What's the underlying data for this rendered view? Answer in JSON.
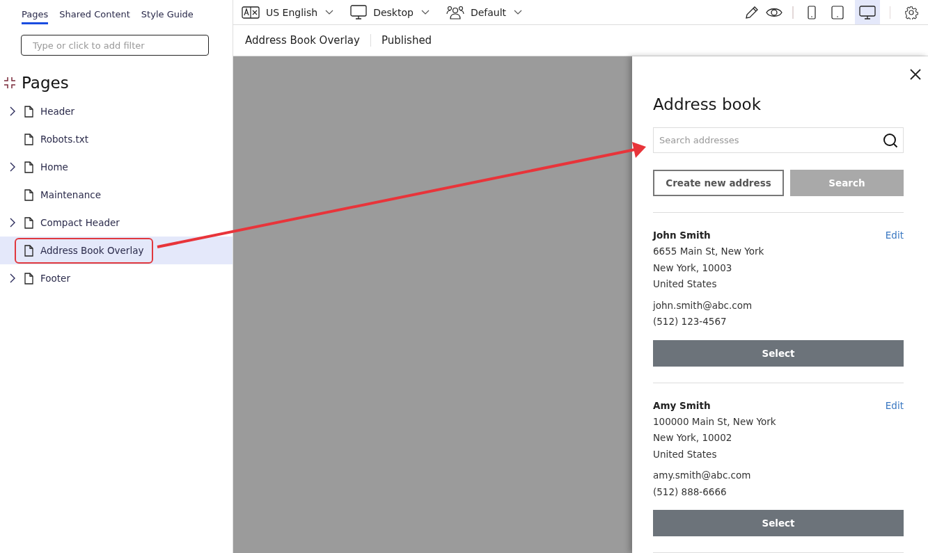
{
  "sidebar": {
    "tabs": [
      {
        "label": "Pages",
        "selected": true
      },
      {
        "label": "Shared Content",
        "selected": false
      },
      {
        "label": "Style Guide",
        "selected": false
      }
    ],
    "filter": {
      "placeholder": "Type or click to add filter"
    },
    "heading": "Pages",
    "items": [
      {
        "label": "Header",
        "expandable": true,
        "selected": false,
        "annotated": false
      },
      {
        "label": "Robots.txt",
        "expandable": false,
        "selected": false,
        "annotated": false
      },
      {
        "label": "Home",
        "expandable": true,
        "selected": false,
        "annotated": false
      },
      {
        "label": "Maintenance",
        "expandable": false,
        "selected": false,
        "annotated": false
      },
      {
        "label": "Compact Header",
        "expandable": true,
        "selected": false,
        "annotated": false
      },
      {
        "label": "Address Book Overlay",
        "expandable": false,
        "selected": true,
        "annotated": true
      },
      {
        "label": "Footer",
        "expandable": true,
        "selected": false,
        "annotated": false
      }
    ]
  },
  "toolbar": {
    "language": "US English",
    "device": "Desktop",
    "audience": "Default",
    "views": [
      {
        "kind": "phone",
        "selected": false
      },
      {
        "kind": "tablet",
        "selected": false
      },
      {
        "kind": "desktop",
        "selected": true
      }
    ]
  },
  "breadcrumb": {
    "page": "Address Book Overlay",
    "status": "Published"
  },
  "overlay": {
    "title": "Address book",
    "search": {
      "placeholder": "Search addresses"
    },
    "create_button": "Create new address",
    "search_button": {
      "label": "Search",
      "disabled": true
    },
    "addresses": [
      {
        "name": "John Smith",
        "edit": "Edit",
        "lines": [
          "6655 Main St, New York",
          "New York, 10003",
          "United States"
        ],
        "email": "john.smith@abc.com",
        "phone": "(512) 123-4567",
        "button": "Select"
      },
      {
        "name": "Amy Smith",
        "edit": "Edit",
        "lines": [
          "100000 Main St, New York",
          "New York, 10002",
          "United States"
        ],
        "email": "amy.smith@abc.com",
        "phone": "(512) 888-6666",
        "button": "Select"
      }
    ]
  }
}
